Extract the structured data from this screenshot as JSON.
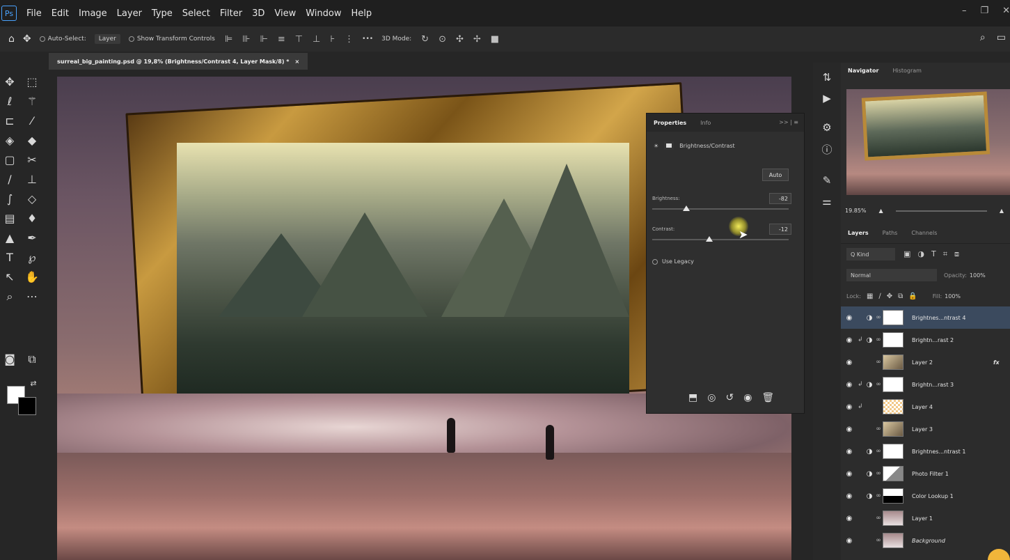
{
  "menubar": {
    "logo": "Ps",
    "items": [
      "File",
      "Edit",
      "Image",
      "Layer",
      "Type",
      "Select",
      "Filter",
      "3D",
      "View",
      "Window",
      "Help"
    ]
  },
  "optionsbar": {
    "auto_select_label": "Auto-Select:",
    "auto_select_value": "Layer",
    "show_transform_label": "Show Transform Controls",
    "mode_3d_label": "3D Mode:",
    "more": "•••"
  },
  "document": {
    "tab_title": "surreal_big_painting.psd @ 19,8% (Brightness/Contrast 4, Layer Mask/8) *",
    "tab_close": "×"
  },
  "properties": {
    "tabs": [
      "Properties",
      "Info"
    ],
    "collapse": ">> | ≡",
    "type_label": "Brightness/Contrast",
    "auto_label": "Auto",
    "brightness_label": "Brightness:",
    "brightness_value": "-82",
    "brightness_fraction": 0.25,
    "contrast_label": "Contrast:",
    "contrast_value": "-12",
    "contrast_fraction": 0.42,
    "use_legacy_label": "Use Legacy"
  },
  "navigator": {
    "tabs": [
      "Navigator",
      "Histogram"
    ],
    "zoom": "19.85%"
  },
  "layers_panel": {
    "tabs": [
      "Layers",
      "Paths",
      "Channels"
    ],
    "kind_label": "Q Kind",
    "blend_mode": "Normal",
    "opacity_label": "Opacity:",
    "opacity_value": "100%",
    "lock_label": "Lock:",
    "fill_label": "Fill:",
    "fill_value": "100%",
    "layers": [
      {
        "name": "Brightnes...ntrast 4",
        "selected": true,
        "clip": false,
        "adj": true,
        "thumb": "white"
      },
      {
        "name": "Brightn...rast 2",
        "selected": false,
        "clip": true,
        "adj": true,
        "thumb": "white"
      },
      {
        "name": "Layer 2",
        "selected": false,
        "clip": false,
        "adj": false,
        "thumb": "img",
        "fx": "fx"
      },
      {
        "name": "Brightn...rast 3",
        "selected": false,
        "clip": true,
        "adj": true,
        "thumb": "white"
      },
      {
        "name": "Layer 4",
        "selected": false,
        "clip": true,
        "adj": false,
        "thumb": "checker"
      },
      {
        "name": "Layer 3",
        "selected": false,
        "clip": false,
        "adj": false,
        "thumb": "img"
      },
      {
        "name": "Brightnes...ntrast 1",
        "selected": false,
        "clip": false,
        "adj": true,
        "thumb": "white"
      },
      {
        "name": "Photo Filter 1",
        "selected": false,
        "clip": false,
        "adj": true,
        "thumb": "half"
      },
      {
        "name": "Color Lookup 1",
        "selected": false,
        "clip": false,
        "adj": true,
        "thumb": "mask"
      },
      {
        "name": "Layer 1",
        "selected": false,
        "clip": false,
        "adj": false,
        "thumb": "bg"
      },
      {
        "name": "Background",
        "selected": false,
        "clip": false,
        "adj": false,
        "thumb": "bg"
      }
    ]
  },
  "colors": {
    "accent": "#4aa3ff",
    "selection": "#3b4a5e",
    "frame_gold": "#c89a40"
  }
}
